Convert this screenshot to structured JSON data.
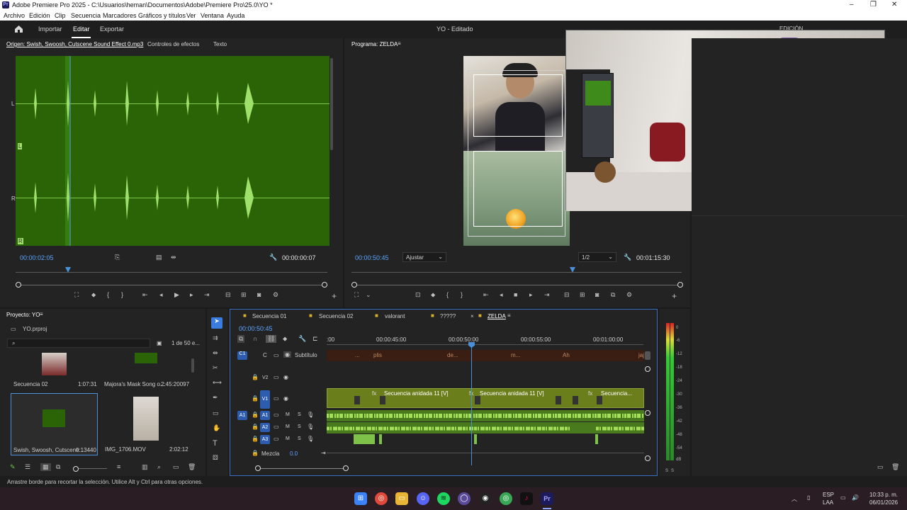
{
  "window": {
    "logo": "Pr",
    "title": "Adobe Premiere Pro 2025 - C:\\Usuarios\\heman\\Documentos\\Adobe\\Premiere Pro\\25.0\\YO *",
    "controls": [
      "–",
      "❐",
      "✕"
    ]
  },
  "menu": [
    "Archivo",
    "Edición",
    "Clip",
    "Secuencia",
    "Marcadores",
    "Gráficos y títulos",
    "Ver",
    "Ventana",
    "Ayuda"
  ],
  "header": {
    "home_icon": "home-icon",
    "tabs": [
      "Importar",
      "Editar",
      "Exportar"
    ],
    "active_tab": "Editar",
    "project_title": "YO - Editado",
    "workspace_label": "EDICIÓN"
  },
  "source": {
    "tabs": [
      "Origen: Swish, Swoosh, Cutscene Sound Effect 0.mp3",
      "Controles de efectos",
      "Texto"
    ],
    "channel_L": "L",
    "channel_R": "R",
    "channel_L_small": "L",
    "channel_R_small": "R",
    "timecode_current": "00:00:02:05",
    "timecode_duration": "00:00:00:07"
  },
  "program": {
    "title": "Programa: ZELDA",
    "timecode_current": "00:00:50:45",
    "fit": "Ajustar",
    "resolution": "1/2",
    "timecode_duration": "00:01:15:30"
  },
  "project": {
    "title": "Proyecto: YO",
    "file": "YO.prproj",
    "search_placeholder": "",
    "count": "1 de 50 e...",
    "items": [
      {
        "name": "Secuencia 02",
        "duration": "1:07:31"
      },
      {
        "name": "Majora's Mask Song o...",
        "duration": "2:45:20097"
      },
      {
        "name": "Swish, Swoosh, Cutscene...",
        "duration": "0:13440"
      },
      {
        "name": "IMG_1706.MOV",
        "duration": "2:02:12"
      }
    ]
  },
  "timeline": {
    "tabs": [
      "Secuencia 01",
      "Secuencia 02",
      "valorant",
      "?????",
      "ZELDA"
    ],
    "active_tab": "ZELDA",
    "timecode": "00:00:50:45",
    "ruler_labels": [
      ":00",
      "00:00:45:00",
      "00:00:50:00",
      "00:00:55:00",
      "00:01:00:00"
    ],
    "caption_track": "Subtítulo",
    "caption_labels": [
      "...",
      "plis",
      "de...",
      "m...",
      "Ah",
      "jaj"
    ],
    "tracks": {
      "v2": "V2",
      "v1": "V1",
      "a1": "A1",
      "a2": "A2",
      "a3": "A3",
      "c1": "C1",
      "mix": "Mezcla",
      "mix_value": "0.0",
      "m": "M",
      "s": "S"
    },
    "clips": [
      "Secuencia anidada 11 [V]",
      "Secuencia anidada 11 [V]",
      "Secuencia..."
    ],
    "fx_label": "fx"
  },
  "meter": {
    "scale": [
      "0",
      "-6",
      "-12",
      "-18",
      "-24",
      "-30",
      "-36",
      "-42",
      "-48",
      "-54",
      "dB"
    ]
  },
  "status": "Arrastre borde para recortar la selección. Utilice Alt y Ctrl para otras opciones.",
  "taskbar": {
    "lang": "ESP",
    "lang2": "LAA",
    "time": "10:33 p. m.",
    "date": "06/01/2026"
  },
  "colors": {
    "waveform_bg": "#2a6406",
    "accent_blue": "#2c5db0",
    "clip_green": "#6a7f1c"
  }
}
